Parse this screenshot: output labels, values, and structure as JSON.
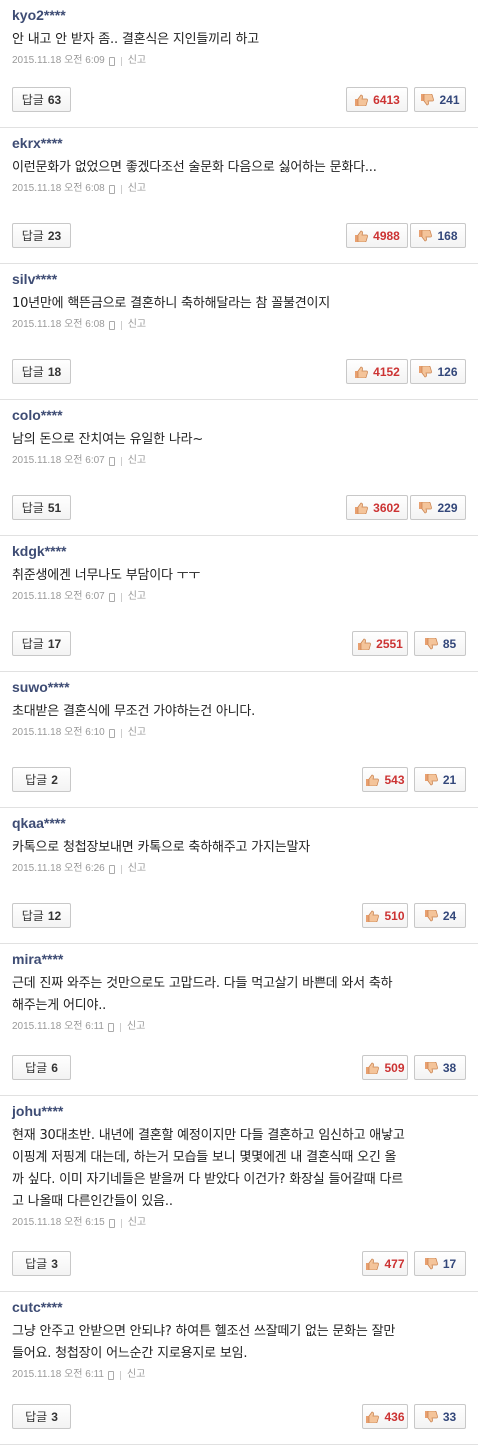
{
  "colors": {
    "username": "#3e4c74",
    "like": "#cc3333",
    "dislike": "#33477a",
    "meta": "#999999"
  },
  "icons": {
    "like": "thumbs-up-icon",
    "dislike": "thumbs-down-icon",
    "device": "mobile-phone-icon"
  },
  "reply_label": "답글",
  "report_label": "신고",
  "comments": [
    {
      "user": "kyo2****",
      "lines": [
        "안 내고 안 받자 좀.. 결혼식은 지인들끼리 하고"
      ],
      "date": "2015.11.18 오전 6:09",
      "replies": "63",
      "likes": "6413",
      "dislikes": "241"
    },
    {
      "user": "ekrx****",
      "lines": [
        "이런문화가 없었으면 좋겠다조선 술문화 다음으로 싫어하는 문화다..."
      ],
      "date": "2015.11.18 오전 6:08",
      "replies": "23",
      "likes": "4988",
      "dislikes": "168"
    },
    {
      "user": "silv****",
      "lines": [
        "10년만에 핵뜬금으로 결혼하니 축하해달라는 참 꼴불견이지"
      ],
      "date": "2015.11.18 오전 6:08",
      "replies": "18",
      "likes": "4152",
      "dislikes": "126"
    },
    {
      "user": "colo****",
      "lines": [
        "남의 돈으로 잔치여는 유일한 나라~"
      ],
      "date": "2015.11.18 오전 6:07",
      "replies": "51",
      "likes": "3602",
      "dislikes": "229"
    },
    {
      "user": "kdgk****",
      "lines": [
        "취준생에겐 너무나도 부담이다 ㅜㅜ"
      ],
      "date": "2015.11.18 오전 6:07",
      "replies": "17",
      "likes": "2551",
      "dislikes": "85"
    },
    {
      "user": "suwo****",
      "lines": [
        "초대받은 결혼식에 무조건 가야하는건 아니다."
      ],
      "date": "2015.11.18 오전 6:10",
      "replies": "2",
      "likes": "543",
      "dislikes": "21"
    },
    {
      "user": "qkaa****",
      "lines": [
        "카톡으로 청첩장보내면 카톡으로 축하해주고 가지는말자"
      ],
      "date": "2015.11.18 오전 6:26",
      "replies": "12",
      "likes": "510",
      "dislikes": "24"
    },
    {
      "user": "mira****",
      "lines": [
        "근데 진짜 와주는 것만으로도 고맙드라. 다들 먹고살기 바쁜데 와서 축하",
        "해주는게 어디야.."
      ],
      "date": "2015.11.18 오전 6:11",
      "replies": "6",
      "likes": "509",
      "dislikes": "38"
    },
    {
      "user": "johu****",
      "lines": [
        "현재 30대초반. 내년에 결혼할 예정이지만 다들 결혼하고 임신하고 애낳고",
        "이핑계 저핑계 대는데, 하는거 모습들 보니 몇몇에겐 내 결혼식때 오긴 올",
        "까 싶다. 이미 자기네들은 받을꺼 다 받았다 이건가? 화장실 들어갈때 다르",
        "고 나올때 다른인간들이 있음.."
      ],
      "date": "2015.11.18 오전 6:15",
      "replies": "3",
      "likes": "477",
      "dislikes": "17"
    },
    {
      "user": "cutc****",
      "lines": [
        "그냥 안주고 안받으면 안되냐? 하여튼 헬조선 쓰잘떼기 없는 문화는 잘만",
        "들어요. 청첩장이 어느순간 지로용지로 보임."
      ],
      "date": "2015.11.18 오전 6:11",
      "replies": "3",
      "likes": "436",
      "dislikes": "33"
    }
  ]
}
